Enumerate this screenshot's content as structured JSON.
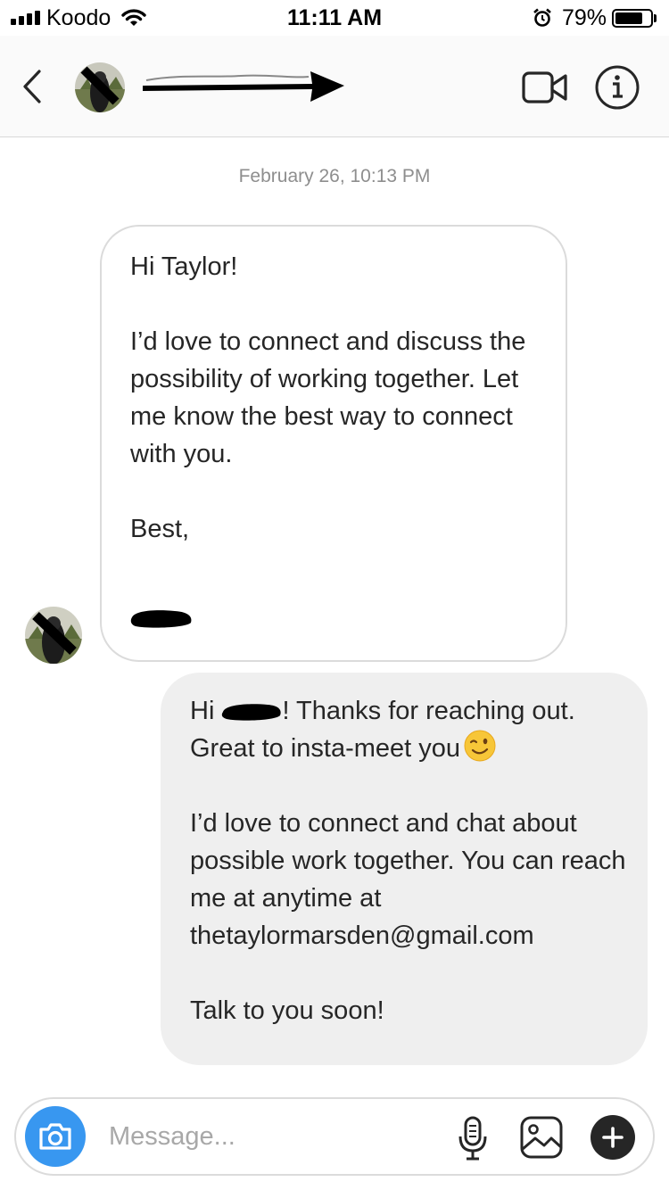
{
  "status_bar": {
    "carrier": "Koodo",
    "time": "11:11 AM",
    "battery_percent": "79%",
    "battery_level": 0.79,
    "icons": [
      "signal-icon",
      "wifi-icon",
      "alarm-icon",
      "battery-icon"
    ]
  },
  "header": {
    "icons": [
      "back-chevron-icon",
      "video-camera-icon",
      "info-icon"
    ]
  },
  "conversation": {
    "timestamp": "February 26, 10:13 PM",
    "incoming_message": {
      "greeting": "Hi Taylor!",
      "body": "I’d love to connect and discuss the possibility of working together. Let me know the best way to connect with you.",
      "closing": "Best,"
    },
    "outgoing_message": {
      "line1_before": "Hi ",
      "line1_after": "! Thanks for reaching out. Great to insta-meet you",
      "emoji": "winking-face-emoji",
      "body": "I’d love to connect and chat about possible work together. You can reach me at anytime at thetaylormarsden@gmail.com",
      "closing": "Talk to you soon!"
    }
  },
  "composer": {
    "placeholder": "Message...",
    "icons": [
      "camera-icon",
      "microphone-icon",
      "gallery-icon",
      "plus-icon"
    ]
  },
  "colors": {
    "accent_blue": "#3897f0",
    "outgoing_bubble": "#efefef",
    "timestamp_gray": "#8e8e8e"
  }
}
